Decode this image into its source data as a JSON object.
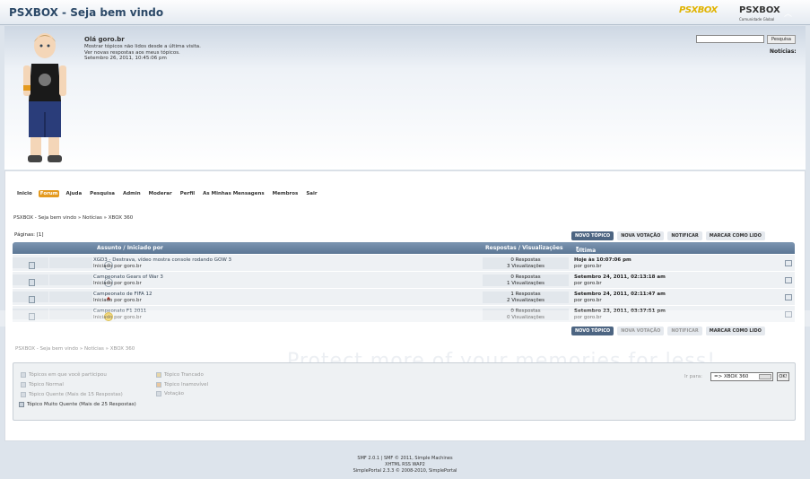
{
  "header": {
    "title": "PSXBOX - Seja bem vindo",
    "logo_left": "PSXBOX",
    "logo_right": "PSXBOX",
    "logo_right_sub": "Comunidade Global"
  },
  "user": {
    "greeting": "Olá goro.br",
    "line1": "Mostrar tópicos não lidos desde a última visita.",
    "line2": "Ver novas respostas aos meus tópicos.",
    "line3": "Setembro 26, 2011, 10:45:06 pm"
  },
  "search": {
    "button": "Pesquisa"
  },
  "news": {
    "label": "Notícias:"
  },
  "menu": [
    "Inicio",
    "Forum",
    "Ajuda",
    "Pesquisa",
    "Admin",
    "Moderar",
    "Perfil",
    "As Minhas Mensagens",
    "Membros",
    "Sair"
  ],
  "breadcrumb": {
    "text": "PSXBOX - Seja bem vindo » Notícias » XBOX 360"
  },
  "pages": "Páginas: [1]",
  "buttons": {
    "new_topic": "NOVO TÓPICO",
    "new_poll": "NOVA VOTAÇÃO",
    "notify": "NOTIFICAR",
    "mark_read": "MARCAR COMO LIDO"
  },
  "table": {
    "col_subject": "Assunto / Iniciado por",
    "col_stats": "Respostas / Visualizações",
    "col_last": "Última mensagem"
  },
  "topics": [
    {
      "title": "XGD3 - Destrava, vídeo mostra console rodando GOW 3",
      "starter": "Iniciado por goro.br",
      "replies": "0 Respostas",
      "views": "3 Visualizações",
      "last_date": "Hoje às 10:07:06 pm",
      "last_by": "por goro.br",
      "icon": "◇"
    },
    {
      "title": "Campeonato Gears of War 3",
      "starter": "Iniciado por goro.br",
      "replies": "0 Respostas",
      "views": "1 Visualizações",
      "last_date": "Setembro 24, 2011, 02:13:18 am",
      "last_by": "por goro.br",
      "icon": "◇"
    },
    {
      "title": "Campeonato de FIFA 12",
      "starter": "Iniciado por goro.br",
      "replies": "1 Respostas",
      "views": "2 Visualizações",
      "last_date": "Setembro 24, 2011, 02:11:47 am",
      "last_by": "por goro.br",
      "icon": "♠"
    },
    {
      "title": "Campeonato F1 2011",
      "starter": "Iniciado por goro.br",
      "replies": "0 Respostas",
      "views": "0 Visualizações",
      "last_date": "Setembro 23, 2011, 03:37:51 pm",
      "last_by": "por goro.br",
      "icon": "☺"
    }
  ],
  "legend": {
    "items": [
      "Tópicos em que você participou",
      "Tópico Normal",
      "Tópico Quente (Mais de 15 Respostas)",
      "Tópico Muito Quente (Mais de 25 Respostas)",
      "Tópico Trancado",
      "Tópico Inamovível",
      "Votação"
    ]
  },
  "jump": {
    "label": "Ir para:",
    "value": "=> XBOX 360",
    "ok": "OK!"
  },
  "footer": {
    "line1": "SMF 2.0.1 | SMF © 2011, Simple Machines",
    "line2": "XHTML RSS WAP2",
    "line3": "SimplePortal 2.3.3 © 2008-2010, SimplePortal"
  },
  "watermark": "Protect more of your memories for less!"
}
